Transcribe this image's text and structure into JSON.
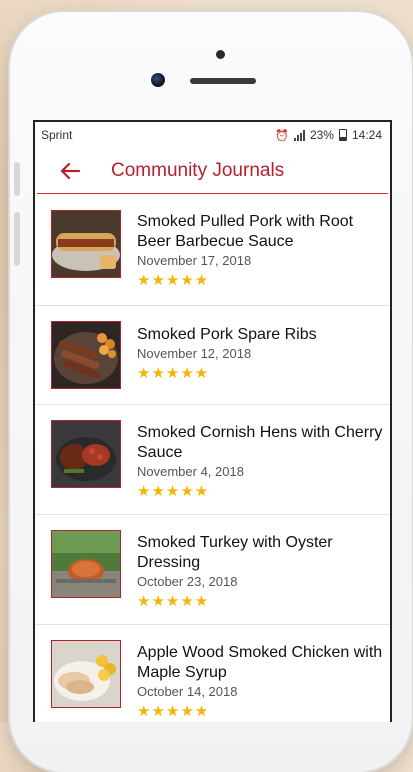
{
  "status_bar": {
    "carrier": "Sprint",
    "battery": "23%",
    "time": "14:24"
  },
  "header": {
    "title": "Community Journals"
  },
  "journals": [
    {
      "title": "Smoked Pulled Pork with Root Beer Barbecue Sauce",
      "date": "November 17, 2018",
      "rating": 5,
      "stars": "★★★★★"
    },
    {
      "title": "Smoked Pork Spare Ribs",
      "date": "November 12, 2018",
      "rating": 5,
      "stars": "★★★★★"
    },
    {
      "title": "Smoked Cornish Hens with Cherry Sauce",
      "date": "November 4, 2018",
      "rating": 5,
      "stars": "★★★★★"
    },
    {
      "title": "Smoked Turkey with Oyster Dressing",
      "date": "October 23, 2018",
      "rating": 5,
      "stars": "★★★★★"
    },
    {
      "title": "Apple Wood Smoked Chicken with Maple Syrup",
      "date": "October 14, 2018",
      "rating": 5,
      "stars": "★★★★★"
    }
  ],
  "colors": {
    "accent": "#b5212e",
    "star": "#f2b705"
  },
  "icons": {
    "back": "arrow-left-icon",
    "alarm": "alarm-icon",
    "signal": "signal-icon",
    "battery": "battery-icon"
  }
}
